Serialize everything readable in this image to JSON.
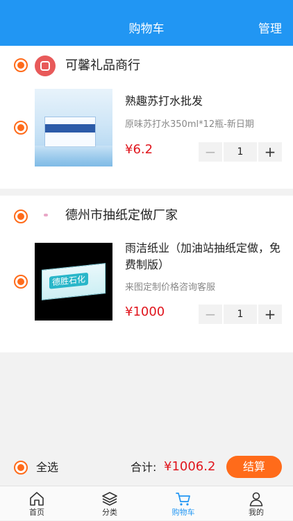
{
  "header": {
    "title": "购物车",
    "manage": "管理"
  },
  "stores": [
    {
      "name": "可馨礼品商行",
      "items": [
        {
          "title": "熟趣苏打水批发",
          "spec": "原味苏打水350ml*12瓶-新日期",
          "price": "¥6.2",
          "qty": "1"
        }
      ]
    },
    {
      "name": "德州市抽纸定做厂家",
      "items": [
        {
          "title": "雨洁纸业（加油站抽纸定做，免费制版）",
          "spec": "来图定制价格咨询客服",
          "price": "¥1000",
          "qty": "1",
          "image_text": "德胜石化"
        }
      ]
    }
  ],
  "stepper": {
    "minus": "−",
    "plus": "+"
  },
  "footer": {
    "select_all": "全选",
    "total_label": "合计:",
    "total_value": "¥1006.2",
    "checkout": "结算"
  },
  "tabbar": [
    {
      "label": "首页",
      "icon": "home-icon"
    },
    {
      "label": "分类",
      "icon": "layers-icon"
    },
    {
      "label": "购物车",
      "icon": "cart-icon",
      "active": true
    },
    {
      "label": "我的",
      "icon": "user-icon"
    }
  ],
  "colors": {
    "header": "#2196f3",
    "accent": "#ff6b1a",
    "price": "#e0151d",
    "active_tab": "#2196f3"
  }
}
